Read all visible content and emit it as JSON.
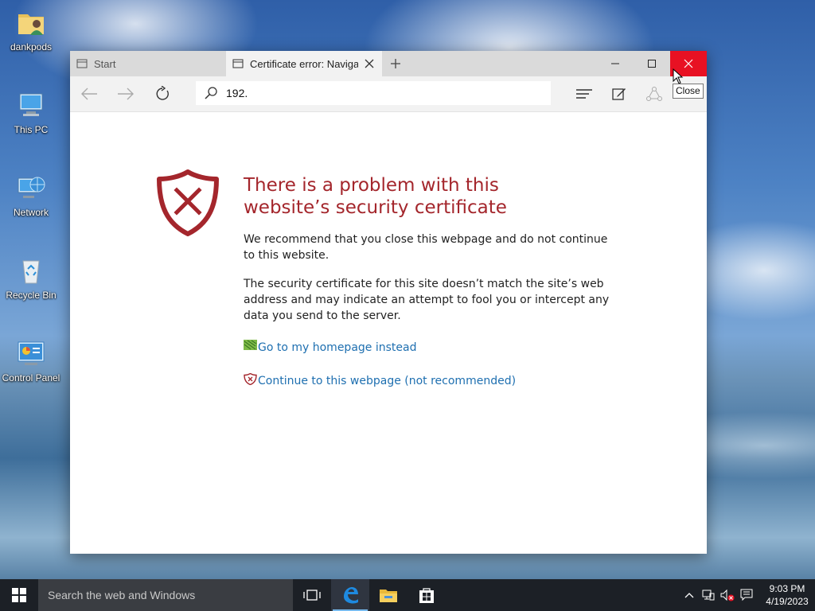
{
  "desktop": {
    "icons": [
      {
        "label": "dankpods",
        "icon": "user-folder-icon"
      },
      {
        "label": "This PC",
        "icon": "computer-icon"
      },
      {
        "label": "Network",
        "icon": "network-icon"
      },
      {
        "label": "Recycle Bin",
        "icon": "recycle-bin-icon"
      },
      {
        "label": "Control Panel",
        "icon": "control-panel-icon"
      }
    ]
  },
  "browser": {
    "tabs": [
      {
        "title": "Start",
        "active": false
      },
      {
        "title": "Certificate error: Navigat",
        "active": true
      }
    ],
    "address": "192.",
    "window_controls": {
      "close_tooltip": "Close"
    }
  },
  "page": {
    "title": "There is a problem with this website’s security certificate",
    "para1": "We recommend that you close this webpage and do not continue to this website.",
    "para2": "The security certificate for this site doesn’t match the site’s web address and may indicate an attempt to fool you or intercept any data you send to the server.",
    "link_home": "Go to my homepage instead",
    "link_continue": "Continue to this webpage (not recommended)",
    "colors": {
      "error": "#a4262c",
      "link": "#1e6fb0",
      "close_button": "#e81123"
    }
  },
  "taskbar": {
    "search_placeholder": "Search the web and Windows",
    "time": "9:03 PM",
    "date": "4/19/2023",
    "apps": [
      "task-view-icon",
      "edge-icon",
      "file-explorer-icon",
      "store-icon"
    ]
  }
}
